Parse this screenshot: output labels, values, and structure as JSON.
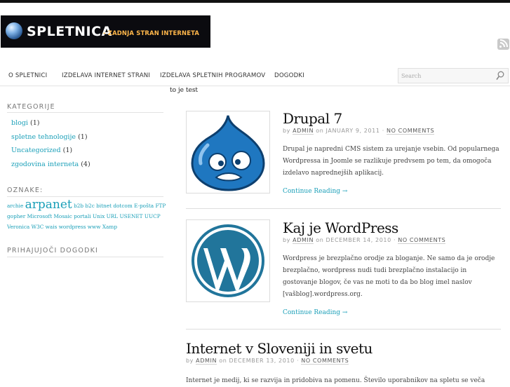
{
  "logo": {
    "title": "SPLETNICA",
    "tagline": "- ZADNJA STRAN INTERNETA"
  },
  "nav": [
    "O SPLETNICI",
    "IZDELAVA INTERNET STRANI",
    "IZDELAVA SPLETNIH PROGRAMOV",
    "DOGODKI"
  ],
  "search": {
    "placeholder": "Search"
  },
  "note": "to je test",
  "sidebar": {
    "categories_title": "KATEGORIJE",
    "categories": [
      {
        "name": "blogi",
        "count": "(1)"
      },
      {
        "name": "spletne tehnologije",
        "count": "(1)"
      },
      {
        "name": "Uncategorized",
        "count": "(1)"
      },
      {
        "name": "zgodovina interneta",
        "count": "(4)"
      }
    ],
    "tags_title": "OZNAKE:",
    "tags": [
      "archie",
      "arpanet",
      "b2b",
      "b2c",
      "bitnet",
      "dotcom",
      "E-pošta",
      "FTP",
      "gopher",
      "Microsoft",
      "Mosaic",
      "portali",
      "Unix",
      "URL",
      "USENET",
      "UUCP",
      "Veronica",
      "W3C",
      "wais",
      "wordpress",
      "www",
      "Xamp"
    ],
    "events_title": "PRIHAJUJOČI DOGODKI"
  },
  "posts": [
    {
      "title": "Drupal 7",
      "by": "by",
      "author": "ADMIN",
      "on": "on",
      "date": "JANUARY 9, 2011",
      "sep": "·",
      "comments": "NO COMMENTS",
      "excerpt": "Drupal je napredni CMS sistem za urejanje vsebin. Od popularnega Wordpressa in Joomle se razlikuje predvsem po tem, da omogoča izdelavo naprednejših aplikacij.",
      "more": "Continue Reading →",
      "image_icon": "drupal-logo"
    },
    {
      "title": "Kaj je WordPress",
      "by": "by",
      "author": "ADMIN",
      "on": "on",
      "date": "DECEMBER 14, 2010",
      "sep": "·",
      "comments": "NO COMMENTS",
      "excerpt": "Wordpress je brezplačno orodje za bloganje. Ne samo da je orodje brezplačno, wordpress nudi tudi brezplačno instalacijo in gostovanje blogov, če vas ne moti to da bo blog imel naslov [vašblog].wordpress.org.",
      "more": "Continue Reading →",
      "image_icon": "wordpress-logo"
    },
    {
      "title": "Internet v Sloveniji in svetu",
      "by": "by",
      "author": "ADMIN",
      "on": "on",
      "date": "DECEMBER 13, 2010",
      "sep": "·",
      "comments": "NO COMMENTS",
      "excerpt": "Internet je medij, ki se razvija in pridobiva na pomenu. Število uporabnikov na spletu se veča"
    }
  ],
  "colors": {
    "link": "#1a9fb8",
    "logo_bg": "#0b0b0f",
    "tagline": "#ffb74a"
  }
}
